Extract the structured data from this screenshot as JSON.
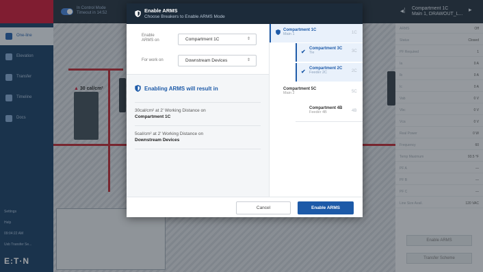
{
  "app": {
    "mode_title": "In Control Mode",
    "mode_sub": "Timeout in 14:52",
    "right_header_title": "Compartment 1C",
    "right_header_sub": "Main 1, DRAWOUT_L...",
    "nav": [
      {
        "label": "One-line"
      },
      {
        "label": "Elevation"
      },
      {
        "label": "Transfer"
      },
      {
        "label": "Timeline"
      },
      {
        "label": "Docs"
      }
    ],
    "settings_label": "Settings",
    "help_label": "Help",
    "time_label": "09:04:22 AM",
    "transfer_label": "Usb Transfer Se...",
    "logo": "E:T·N",
    "hazard_label": "30 cal/cm²",
    "right_rows": [
      {
        "k": "ARMS",
        "v": "Off"
      },
      {
        "k": "Status",
        "v": "Closed"
      },
      {
        "k": "PF Required",
        "v": "1"
      },
      {
        "k": "Ia",
        "v": "0 A"
      },
      {
        "k": "Ib",
        "v": "0 A"
      },
      {
        "k": "Ic",
        "v": "0 A"
      },
      {
        "k": "Vab",
        "v": "0 V"
      },
      {
        "k": "Vbc",
        "v": "0 V"
      },
      {
        "k": "Vca",
        "v": "0 V"
      },
      {
        "k": "Real Power",
        "v": "0 W"
      },
      {
        "k": "Frequency",
        "v": "60"
      },
      {
        "k": "Temp Maximum",
        "v": "93.5 °F"
      },
      {
        "k": "PF A",
        "v": "—"
      },
      {
        "k": "PF B",
        "v": "—"
      },
      {
        "k": "PF C",
        "v": "—"
      },
      {
        "k": "Line Size Avail.",
        "v": "120 VAC"
      }
    ],
    "enable_arms_side": "Enable ARMS",
    "transfer_scheme": "Transfer Scheme"
  },
  "modal": {
    "title": "Enable ARMS",
    "subtitle": "Choose Breakers to Enable ARMS Mode",
    "enable_on_label": "Enable\nARMS on",
    "enable_on_value": "Compartment 1C",
    "work_on_label": "For work on",
    "work_on_value": "Downstream Devices",
    "result_heading": "Enabling ARMS will result in",
    "result_1_text": "30cal/cm² at 2' Working Distance on",
    "result_1_target": "Compartment 1C",
    "result_2_text": "5cal/cm² at 2' Working Distance on",
    "result_2_target": "Downstream Devices",
    "tree": [
      {
        "name": "Compartment 1C",
        "sub": "Main 1",
        "code": "1C"
      },
      {
        "name": "Compartment 3C",
        "sub": "Tie",
        "code": "3C"
      },
      {
        "name": "Compartment 2C",
        "sub": "Feeder 2C",
        "code": "2C"
      },
      {
        "name": "Compartment 5C",
        "sub": "Main 2",
        "code": "5C"
      },
      {
        "name": "Compartment 4B",
        "sub": "Feeder 4B",
        "code": "4B"
      }
    ],
    "cancel_label": "Cancel",
    "enable_label": "Enable ARMS"
  },
  "colors": {
    "accent": "#1d5aa8",
    "header": "#1c2b3a",
    "brand_red": "#c8102e"
  }
}
